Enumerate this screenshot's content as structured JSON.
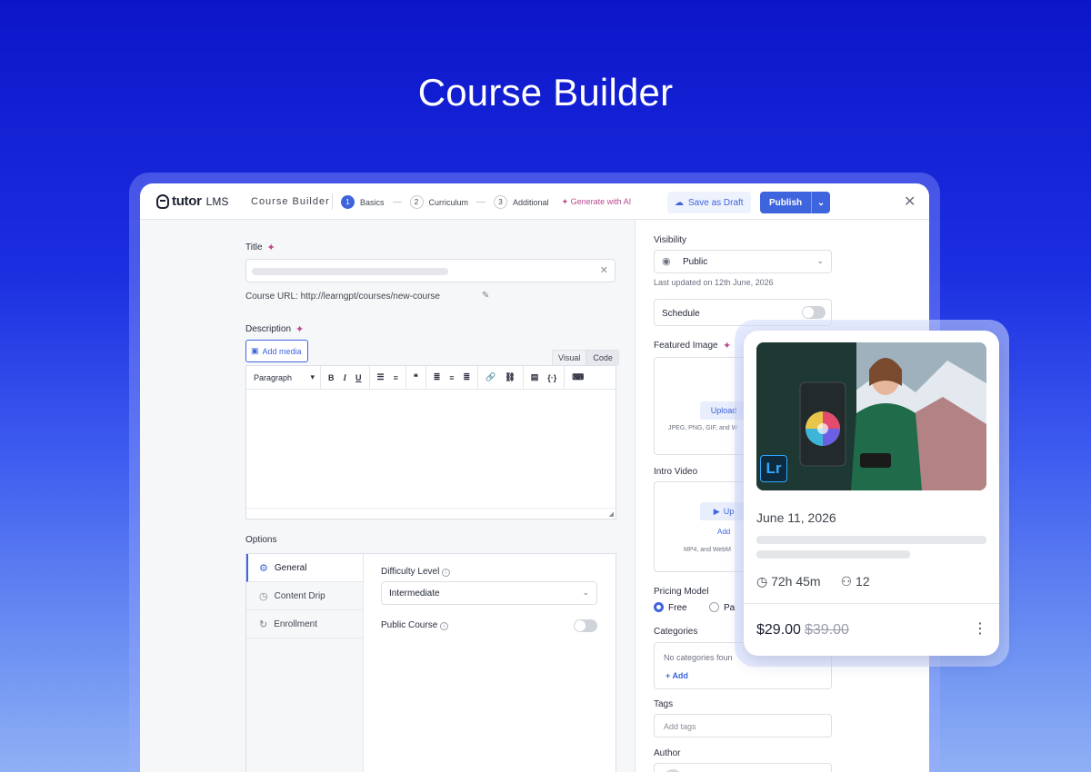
{
  "hero": {
    "title": "Course Builder"
  },
  "header": {
    "logo_text": "tutor",
    "logo_sub": "LMS",
    "builder_label": "Course Builder",
    "steps": [
      {
        "num": "1",
        "label": "Basics",
        "active": true
      },
      {
        "num": "2",
        "label": "Curriculum",
        "active": false
      },
      {
        "num": "3",
        "label": "Additional",
        "active": false
      }
    ],
    "ai_label": "Generate with AI",
    "save_draft": "Save as Draft",
    "publish": "Publish"
  },
  "main": {
    "title_label": "Title",
    "course_url": "Course URL: http://learngpt/courses/new-course",
    "description_label": "Description",
    "add_media": "Add media",
    "tab_visual": "Visual",
    "tab_code": "Code",
    "paragraph": "Paragraph",
    "options_label": "Options",
    "option_tabs": [
      {
        "label": "General",
        "icon": "gear-icon",
        "active": true
      },
      {
        "label": "Content Drip",
        "icon": "clock-icon",
        "active": false
      },
      {
        "label": "Enrollment",
        "icon": "refresh-icon",
        "active": false
      }
    ],
    "difficulty_label": "Difficulty Level",
    "difficulty_value": "Intermediate",
    "public_course_label": "Public Course",
    "public_course_on": false
  },
  "sidebar": {
    "visibility_label": "Visibility",
    "visibility_value": "Public",
    "last_updated": "Last updated on 12th June, 2026",
    "schedule_label": "Schedule",
    "schedule_on": false,
    "featured_image_label": "Featured Image",
    "upload_label": "Upload",
    "image_formats": "JPEG, PNG, GIF, and W",
    "intro_video_label": "Intro Video",
    "video_upload_label": "Up",
    "video_add_label": "Add",
    "video_formats": "MP4, and WebM",
    "pricing_label": "Pricing Model",
    "pricing_free": "Free",
    "pricing_paid": "Pa",
    "categories_label": "Categories",
    "no_categories": "No categories foun",
    "add_category": "Add",
    "tags_label": "Tags",
    "tags_placeholder": "Add tags",
    "author_label": "Author"
  },
  "card": {
    "app_badge": "Lr",
    "date": "June 11, 2026",
    "duration": "72h 45m",
    "students": "12",
    "price": "$29.00",
    "old_price": "$39.00"
  },
  "colors": {
    "accent": "#3e64de",
    "ai": "#b84a8f",
    "bg_top": "#0d15c9"
  }
}
